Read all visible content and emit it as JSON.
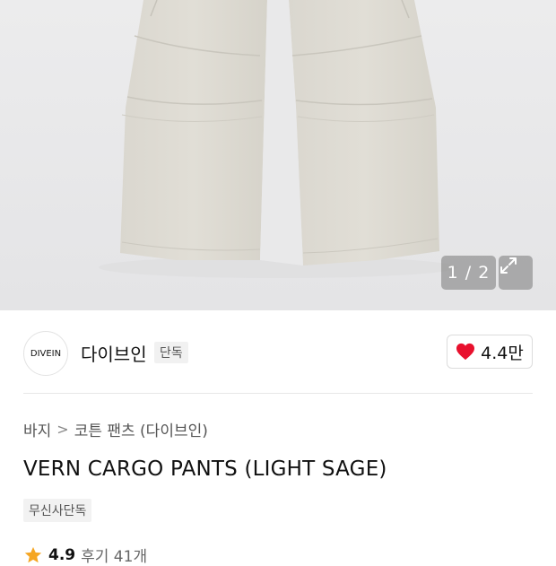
{
  "gallery": {
    "counter_label": "1 / 2",
    "expand_icon": "expand-arrows-icon"
  },
  "brand": {
    "logo_text": "DIVEIN",
    "name": "다이브인",
    "tag": "단독",
    "like_icon": "heart-icon",
    "like_count": "4.4만",
    "accent_color": "#e8102d"
  },
  "breadcrumb": {
    "items": [
      "바지",
      "코튼 팬츠 (다이브인)"
    ],
    "separator": ">"
  },
  "product": {
    "title": "VERN CARGO PANTS (LIGHT SAGE)",
    "badge": "무신사단독"
  },
  "rating": {
    "star_icon": "star-icon",
    "score": "4.9",
    "reviews": "후기 41개",
    "star_color": "#f5a623"
  }
}
